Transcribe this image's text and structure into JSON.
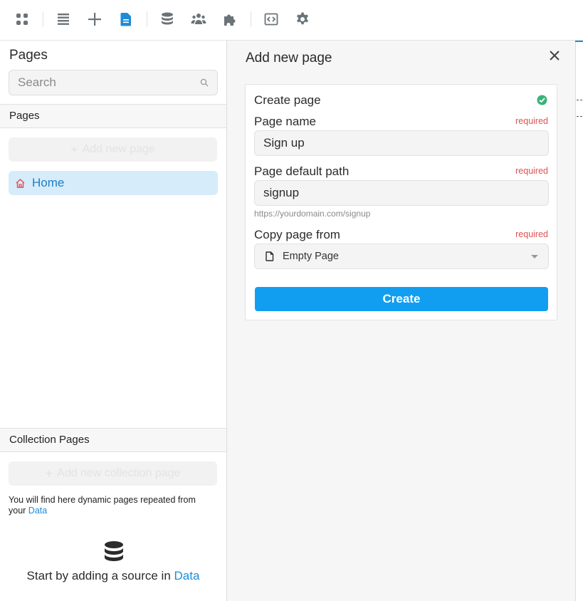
{
  "toolbar": {
    "icons": [
      "apps-icon",
      "layers-icon",
      "plus-icon",
      "page-icon",
      "database-icon",
      "users-icon",
      "puzzle-icon",
      "code-icon",
      "gear-icon"
    ],
    "active_color": "#1e8bd6",
    "icon_color": "#6b7378"
  },
  "left_panel": {
    "title": "Pages",
    "search_placeholder": "Search",
    "pages_section": "Pages",
    "add_page_label": "Add new page",
    "pages": [
      {
        "label": "Home",
        "icon": "home-icon"
      }
    ],
    "collection_section": "Collection Pages",
    "add_collection_label": "Add new collection page",
    "help_text": "You will find here dynamic pages repeated from your ",
    "help_link": "Data",
    "start_text": "Start by adding a source in ",
    "start_link": "Data"
  },
  "form": {
    "title": "Add new page",
    "card_title": "Create page",
    "page_name_label": "Page name",
    "page_name_value": "Sign up",
    "path_label": "Page default path",
    "path_value": "signup",
    "path_hint": "https://yourdomain.com/signup",
    "copy_label": "Copy page from",
    "copy_value": "Empty Page",
    "required_text": "required",
    "create_label": "Create"
  }
}
